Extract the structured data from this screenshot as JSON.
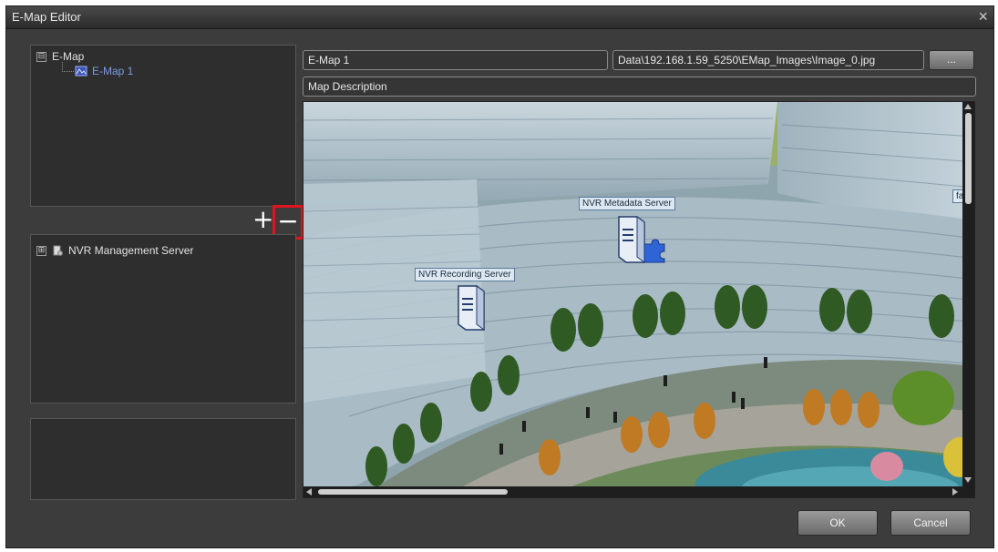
{
  "window": {
    "title": "E-Map Editor",
    "close_glyph": "×"
  },
  "emap_tree": {
    "root_label": "E-Map",
    "root_expander": "⊟",
    "child_label": "E-Map 1",
    "child_icon": "map-icon"
  },
  "emap_toolbar": {
    "add_glyph": "+",
    "remove_glyph": "−"
  },
  "device_tree": {
    "root_label": "NVR Management Server",
    "root_expander": "⊞",
    "root_icon": "server-tree-icon"
  },
  "map_form": {
    "name_value": "E-Map 1",
    "image_path_value": "Data\\192.168.1.59_5250\\EMap_Images\\Image_0.jpg",
    "browse_label": "...",
    "description_value": "Map Description"
  },
  "map_devices": [
    {
      "label": "NVR Metadata Server",
      "icon": "metadata-server-icon"
    },
    {
      "label": "NVR Recording Server",
      "icon": "recording-server-icon"
    }
  ],
  "map_edge_label": "fa",
  "footer": {
    "ok_label": "OK",
    "cancel_label": "Cancel"
  },
  "colors": {
    "highlight_box": "#e0141e",
    "window_bg": "#3c3c3c",
    "panel_bg": "#2e2e2e"
  }
}
